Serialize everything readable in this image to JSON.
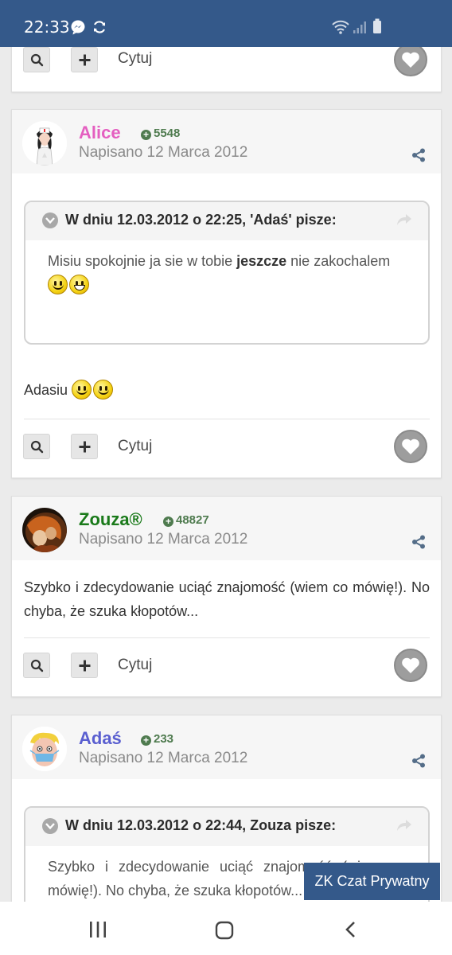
{
  "status_bar": {
    "time": "22:33"
  },
  "colors": {
    "header_blue": "#34598a",
    "rep_green": "#4f7b4f",
    "alice": "#e45fc0",
    "zouza": "#1a7a1a",
    "adas": "#5a5fd0"
  },
  "actions": {
    "cite_label": "Cytuj"
  },
  "posts": [
    {
      "author": "Alice",
      "reputation": "5548",
      "posted": "Napisano 12 Marca 2012",
      "quote": {
        "citation": "W dniu 12.03.2012 o 22:25, 'Adaś' pisze:",
        "text_before": "Misiu spokojnie ja sie w tobie ",
        "text_bold": "jeszcze",
        "text_after": " nie zakochalem"
      },
      "text": "Adasiu"
    },
    {
      "author": "Zouza®",
      "reputation": "48827",
      "posted": "Napisano 12 Marca 2012",
      "text": "Szybko i zdecydowanie uciąć znajomość (wiem co mówię!). No chyba, że szuka kłopotów..."
    },
    {
      "author": "Adaś",
      "reputation": "233",
      "posted": "Napisano 12 Marca 2012",
      "quote": {
        "citation": "W dniu 12.03.2012 o 22:44, Zouza pisze:",
        "text": "Szybko i zdecydowanie uciąć znajomość (wiem co mówię!). No chyba, że szuka kłopotów..."
      }
    }
  ],
  "chat_button": "ZK Czat Prywatny"
}
